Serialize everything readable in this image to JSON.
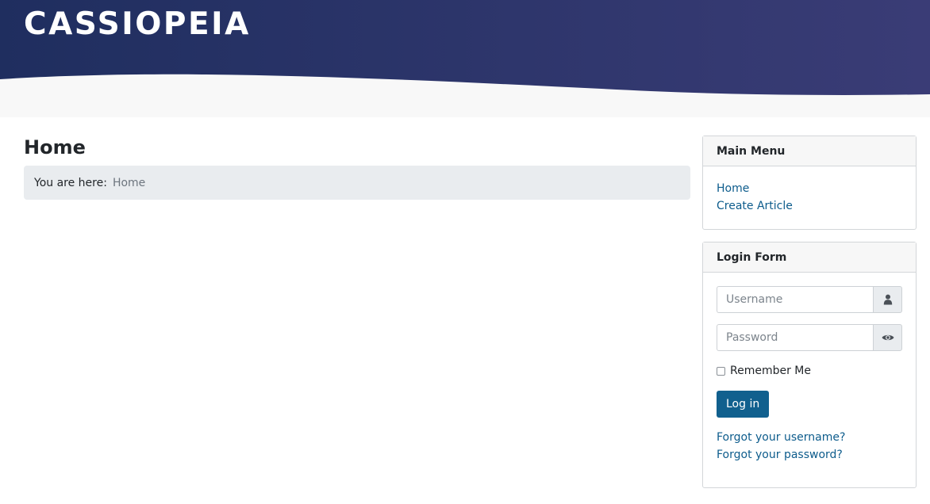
{
  "header": {
    "brand": "CASSIOPEIA",
    "colors": {
      "gradient_start": "#1f2e5f",
      "gradient_end": "#3a3c76",
      "band": "#f8f8f8"
    }
  },
  "main": {
    "title": "Home",
    "breadcrumb": {
      "prefix": "You are here:",
      "current": "Home"
    }
  },
  "main_menu": {
    "title": "Main Menu",
    "items": [
      {
        "label": "Home"
      },
      {
        "label": "Create Article"
      }
    ]
  },
  "login_form": {
    "title": "Login Form",
    "username_placeholder": "Username",
    "password_placeholder": "Password",
    "username_icon": "user-icon",
    "password_icon": "eye-icon",
    "remember_label": "Remember Me",
    "submit_label": "Log in",
    "links": [
      {
        "label": "Forgot your username?"
      },
      {
        "label": "Forgot your password?"
      }
    ]
  },
  "colors": {
    "link": "#0d5c8c",
    "button": "#11608e",
    "breadcrumb_bg": "#e9ecef"
  }
}
